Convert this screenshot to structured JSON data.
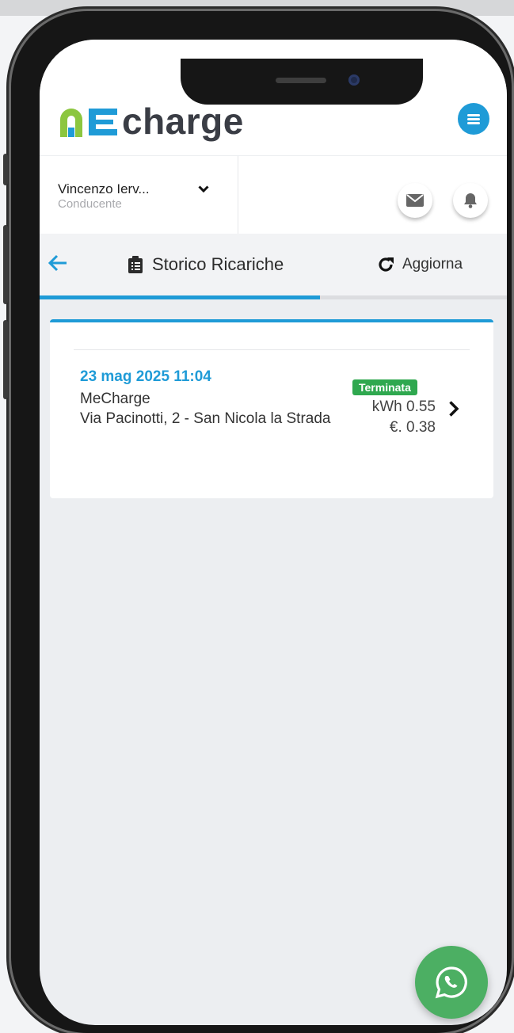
{
  "app": {
    "logo_text": "charge",
    "brand_colors": {
      "green": "#8cc63f",
      "blue": "#1f9bd7"
    }
  },
  "user": {
    "name": "Vincenzo Ierv...",
    "role": "Conducente"
  },
  "tabbar": {
    "title": "Storico Ricariche",
    "refresh_label": "Aggiorna",
    "progress_fraction": 0.6
  },
  "charges": [
    {
      "date": "23 mag 2025 11:04",
      "company": "MeCharge",
      "address": "Via Pacinotti, 2 - San Nicola la Strada",
      "status": "Terminata",
      "status_color": "#2fa84f",
      "energy": "kWh 0.55",
      "price": "€. 0.38"
    }
  ],
  "icons": {
    "menu": "hamburger-icon",
    "mail": "envelope-icon",
    "bell": "bell-icon",
    "back": "arrow-left-icon",
    "clipboard": "clipboard-list-icon",
    "refresh": "redo-icon",
    "chevron": "chevron-right-icon",
    "whatsapp": "whatsapp-icon"
  }
}
